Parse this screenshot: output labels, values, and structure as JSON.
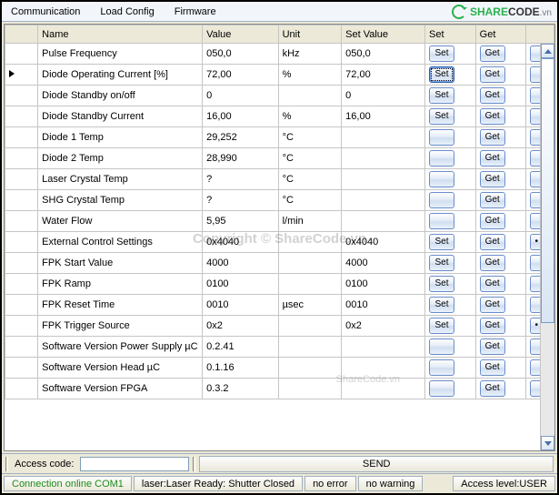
{
  "menu": {
    "items": [
      "Communication",
      "Load Config",
      "Firmware"
    ]
  },
  "brand": {
    "share": "SHARE",
    "code": "CODE",
    "vn": ".vn"
  },
  "columns": {
    "name": "Name",
    "value": "Value",
    "unit": "Unit",
    "setvalue": "Set Value",
    "set": "Set",
    "get": "Get"
  },
  "buttons": {
    "set": "Set",
    "get": "Get",
    "ext": "•"
  },
  "current_row": 1,
  "rows": [
    {
      "name": "Pulse Frequency",
      "value": "050,0",
      "unit": "kHz",
      "setvalue": "050,0",
      "set": true,
      "get": true,
      "ext": false
    },
    {
      "name": "Diode Operating Current [%]",
      "value": "72,00",
      "unit": "%",
      "setvalue": "72,00",
      "set": true,
      "get": true,
      "ext": false,
      "set_focused": true
    },
    {
      "name": "Diode Standby on/off",
      "value": "0",
      "unit": "",
      "setvalue": "0",
      "set": true,
      "get": true,
      "ext": false
    },
    {
      "name": "Diode Standby Current",
      "value": "16,00",
      "unit": "%",
      "setvalue": "16,00",
      "set": true,
      "get": true,
      "ext": false
    },
    {
      "name": "Diode 1 Temp",
      "value": "29,252",
      "unit": "°C",
      "setvalue": "",
      "set": false,
      "get": true,
      "ext": false
    },
    {
      "name": "Diode 2 Temp",
      "value": "28,990",
      "unit": "°C",
      "setvalue": "",
      "set": false,
      "get": true,
      "ext": false
    },
    {
      "name": "Laser Crystal Temp",
      "value": "?",
      "unit": "°C",
      "setvalue": "",
      "set": false,
      "get": true,
      "ext": false
    },
    {
      "name": "SHG Crystal Temp",
      "value": "?",
      "unit": "°C",
      "setvalue": "",
      "set": false,
      "get": true,
      "ext": false
    },
    {
      "name": "Water Flow",
      "value": "5,95",
      "unit": "l/min",
      "setvalue": "",
      "set": false,
      "get": true,
      "ext": false
    },
    {
      "name": "External Control Settings",
      "value": "0x4040",
      "unit": "",
      "setvalue": "0x4040",
      "set": true,
      "get": true,
      "ext": true
    },
    {
      "name": "FPK Start Value",
      "value": "4000",
      "unit": "",
      "setvalue": "4000",
      "set": true,
      "get": true,
      "ext": false
    },
    {
      "name": "FPK Ramp",
      "value": "0100",
      "unit": "",
      "setvalue": "0100",
      "set": true,
      "get": true,
      "ext": false
    },
    {
      "name": "FPK Reset Time",
      "value": "0010",
      "unit": "µsec",
      "setvalue": "0010",
      "set": true,
      "get": true,
      "ext": false
    },
    {
      "name": "FPK Trigger Source",
      "value": "0x2",
      "unit": "",
      "setvalue": "0x2",
      "set": true,
      "get": true,
      "ext": true
    },
    {
      "name": "Software Version Power Supply µC",
      "value": "0.2.41",
      "unit": "",
      "setvalue": "",
      "set": false,
      "get": true,
      "ext": false
    },
    {
      "name": "Software Version Head µC",
      "value": "0.1.16",
      "unit": "",
      "setvalue": "",
      "set": false,
      "get": true,
      "ext": false
    },
    {
      "name": "Software Version FPGA",
      "value": "0.3.2",
      "unit": "",
      "setvalue": "",
      "set": false,
      "get": true,
      "ext": false
    }
  ],
  "dock": {
    "access_code_label": "Access code:",
    "access_code_value": "",
    "send_label": "SEND"
  },
  "status": {
    "connection": "Connection online COM1",
    "laser": "laser:Laser Ready: Shutter Closed",
    "error": "no error",
    "warning": "no warning",
    "access": "Access level:USER"
  },
  "watermark": "Copyright © ShareCode.vn",
  "watermark2": "ShareCode.vn"
}
